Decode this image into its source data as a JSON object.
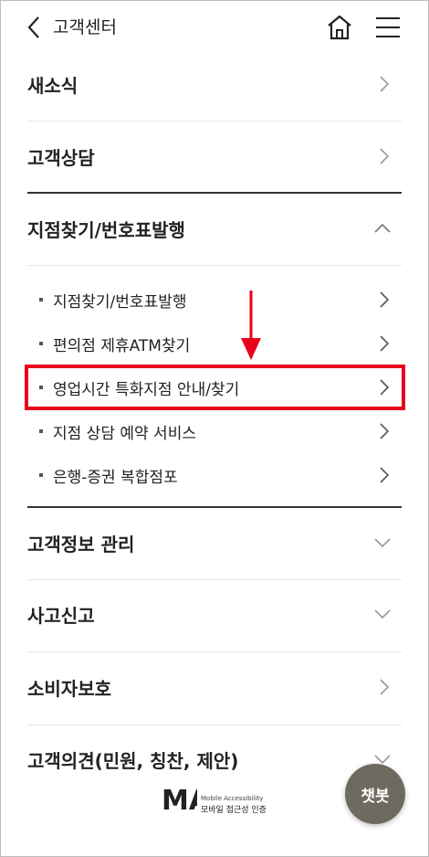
{
  "header": {
    "title": "고객센터",
    "back_icon": "chevron-left-icon",
    "home_icon": "home-icon",
    "menu_icon": "hamburger-menu-icon"
  },
  "menu": {
    "news": "새소식",
    "consult": "고객상담",
    "branch": "지점찾기/번호표발행",
    "branch_sub": [
      "지점찾기/번호표발행",
      "편의점 제휴ATM찾기",
      "영업시간 특화지점 안내/찾기",
      "지점 상담 예약 서비스",
      "은행-증권 복합점포"
    ],
    "info": "고객정보 관리",
    "accident": "사고신고",
    "consumer": "소비자보호",
    "opinion": "고객의견(민원, 칭찬, 제안)"
  },
  "chatbot_label": "챗봇",
  "badge": {
    "mark": "MA",
    "en": "Mobile Accessibility",
    "ko": "모바일 접근성 인증"
  },
  "colors": {
    "highlight": "#e8001c",
    "chatbot_bg": "#6f6a5f"
  }
}
